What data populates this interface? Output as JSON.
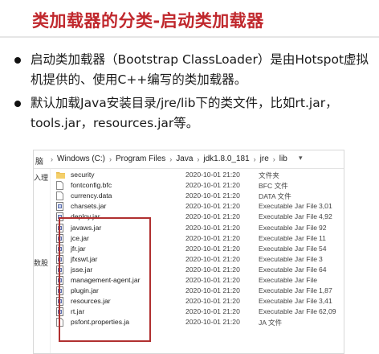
{
  "slide": {
    "title": "类加载器的分类-启动类加载器",
    "bullets": [
      "启动类加载器（Bootstrap ClassLoader）是由Hotspot虚拟机提供的、使用C++编写的类加载器。",
      "默认加载Java安装目录/jre/lib下的类文件，比如rt.jar，tools.jar，resources.jar等。"
    ]
  },
  "explorer": {
    "address_cut": "脑",
    "breadcrumbs": [
      "Windows (C:)",
      "Program Files",
      "Java",
      "jdk1.8.0_181",
      "jre",
      "lib"
    ],
    "nav_fragments": [
      "入理",
      "数股"
    ],
    "files": [
      {
        "name": "security",
        "date": "2020-10-01 21:20",
        "type": "文件夹",
        "size": "",
        "icon": "folder-icon"
      },
      {
        "name": "fontconfig.bfc",
        "date": "2020-10-01 21:20",
        "type": "BFC 文件",
        "size": "",
        "icon": "file-icon"
      },
      {
        "name": "currency.data",
        "date": "2020-10-01 21:20",
        "type": "DATA 文件",
        "size": "",
        "icon": "file-icon"
      },
      {
        "name": "charsets.jar",
        "date": "2020-10-01 21:20",
        "type": "Executable Jar File",
        "size": "3,01",
        "icon": "jar-icon"
      },
      {
        "name": "deploy.jar",
        "date": "2020-10-01 21:20",
        "type": "Executable Jar File",
        "size": "4,92",
        "icon": "jar-icon"
      },
      {
        "name": "javaws.jar",
        "date": "2020-10-01 21:20",
        "type": "Executable Jar File",
        "size": "92",
        "icon": "jar-icon"
      },
      {
        "name": "jce.jar",
        "date": "2020-10-01 21:20",
        "type": "Executable Jar File",
        "size": "11",
        "icon": "jar-icon"
      },
      {
        "name": "jfr.jar",
        "date": "2020-10-01 21:20",
        "type": "Executable Jar File",
        "size": "54",
        "icon": "jar-icon"
      },
      {
        "name": "jfxswt.jar",
        "date": "2020-10-01 21:20",
        "type": "Executable Jar File",
        "size": "3",
        "icon": "jar-icon"
      },
      {
        "name": "jsse.jar",
        "date": "2020-10-01 21:20",
        "type": "Executable Jar File",
        "size": "64",
        "icon": "jar-icon"
      },
      {
        "name": "management-agent.jar",
        "date": "2020-10-01 21:20",
        "type": "Executable Jar File",
        "size": "",
        "icon": "jar-icon"
      },
      {
        "name": "plugin.jar",
        "date": "2020-10-01 21:20",
        "type": "Executable Jar File",
        "size": "1,87",
        "icon": "jar-icon"
      },
      {
        "name": "resources.jar",
        "date": "2020-10-01 21:20",
        "type": "Executable Jar File",
        "size": "3,41",
        "icon": "jar-icon"
      },
      {
        "name": "rt.jar",
        "date": "2020-10-01 21:20",
        "type": "Executable Jar File",
        "size": "62,09",
        "icon": "jar-icon"
      },
      {
        "name": "psfont.properties.ja",
        "date": "2020-10-01 21:20",
        "type": "JA 文件",
        "size": "",
        "icon": "file-icon"
      }
    ]
  },
  "colors": {
    "title": "#c0282d",
    "highlight_border": "#b03030",
    "folder": "#e8b84a"
  }
}
